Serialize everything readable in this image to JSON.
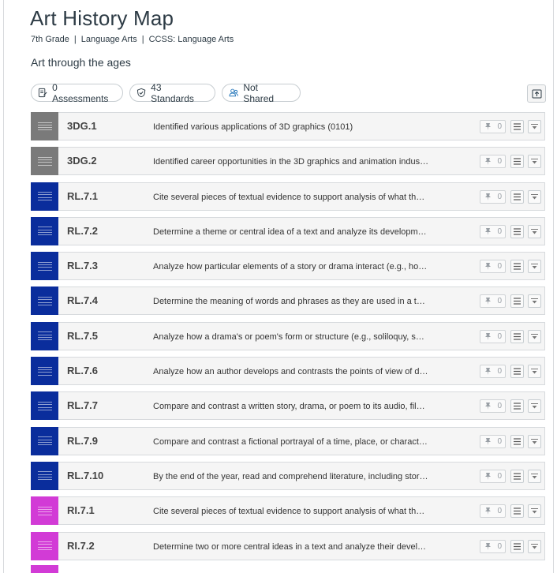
{
  "header": {
    "title": "Art History Map",
    "grade": "7th Grade",
    "subject": "Language Arts",
    "framework": "CCSS: Language Arts",
    "description": "Art through the ages"
  },
  "pills": {
    "assessments": "0 Assessments",
    "standards": "43 Standards",
    "sharing": "Not Shared"
  },
  "colors": {
    "gray": "#7a7a7a",
    "blue": "#0a2d9c",
    "magenta": "#d23bd6"
  },
  "standards": [
    {
      "code": "3DG.1",
      "text": "Identified various applications of 3D graphics (0101)",
      "color": "#7a7a7a",
      "count": "0"
    },
    {
      "code": "3DG.2",
      "text": "Identified career opportunities in the 3D graphics and animation indus…",
      "color": "#7a7a7a",
      "count": "0"
    },
    {
      "code": "RL.7.1",
      "text": "Cite several pieces of textual evidence to support analysis of what the…",
      "color": "#0a2d9c",
      "count": "0"
    },
    {
      "code": "RL.7.2",
      "text": "Determine a theme or central idea of a text and analyze its developm…",
      "color": "#0a2d9c",
      "count": "0"
    },
    {
      "code": "RL.7.3",
      "text": "Analyze how particular elements of a story or drama interact (e.g., ho…",
      "color": "#0a2d9c",
      "count": "0"
    },
    {
      "code": "RL.7.4",
      "text": "Determine the meaning of words and phrases as they are used in a te…",
      "color": "#0a2d9c",
      "count": "0"
    },
    {
      "code": "RL.7.5",
      "text": "Analyze how a drama's or poem's form or structure (e.g., soliloquy, so…",
      "color": "#0a2d9c",
      "count": "0"
    },
    {
      "code": "RL.7.6",
      "text": "Analyze how an author develops and contrasts the points of view of di…",
      "color": "#0a2d9c",
      "count": "0"
    },
    {
      "code": "RL.7.7",
      "text": "Compare and contrast a written story, drama, or poem to its audio, fil…",
      "color": "#0a2d9c",
      "count": "0"
    },
    {
      "code": "RL.7.9",
      "text": "Compare and contrast a fictional portrayal of a time, place, or charact…",
      "color": "#0a2d9c",
      "count": "0"
    },
    {
      "code": "RL.7.10",
      "text": "By the end of the year, read and comprehend literature, including stori…",
      "color": "#0a2d9c",
      "count": "0"
    },
    {
      "code": "RI.7.1",
      "text": "Cite several pieces of textual evidence to support analysis of what the…",
      "color": "#d23bd6",
      "count": "0"
    },
    {
      "code": "RI.7.2",
      "text": "Determine two or more central ideas in a text and analyze their devel…",
      "color": "#d23bd6",
      "count": "0"
    }
  ]
}
